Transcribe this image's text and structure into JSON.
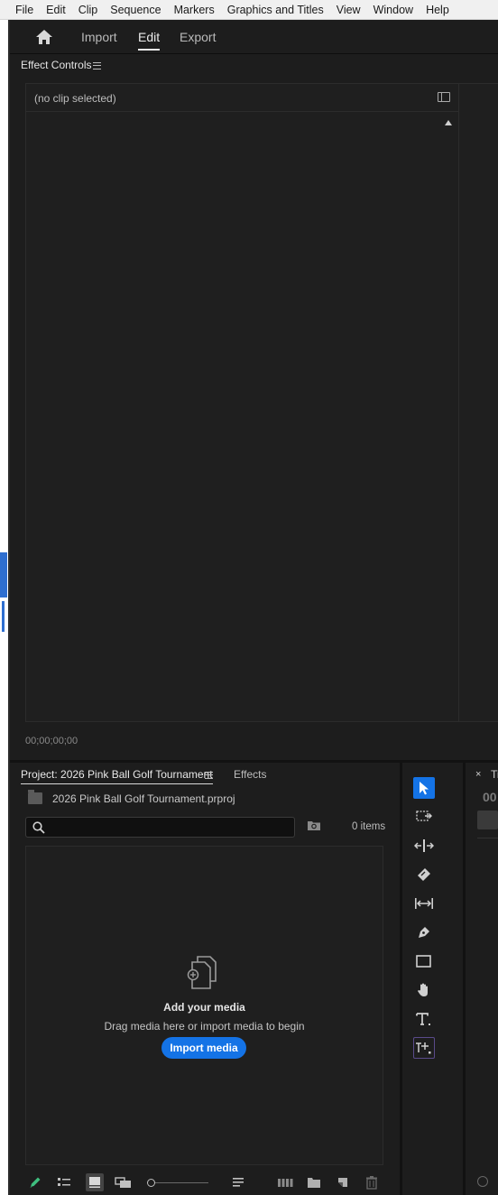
{
  "menu": [
    "File",
    "Edit",
    "Clip",
    "Sequence",
    "Markers",
    "Graphics and Titles",
    "View",
    "Window",
    "Help"
  ],
  "header": {
    "tabs": [
      {
        "label": "Import",
        "active": false
      },
      {
        "label": "Edit",
        "active": true
      },
      {
        "label": "Export",
        "active": false
      }
    ]
  },
  "effect_controls": {
    "title": "Effect Controls",
    "clip_status": "(no clip selected)",
    "timecode": "00;00;00;00"
  },
  "project": {
    "tab_label": "Project: 2026 Pink Ball Golf Tournament",
    "effects_tab": "Effects",
    "file_name": "2026 Pink Ball Golf Tournament.prproj",
    "search_value": "",
    "items_count": "0 items",
    "empty_title": "Add your media",
    "empty_subtitle": "Drag media here or import media to begin",
    "import_button": "Import media"
  },
  "timeline": {
    "close_glyph": "×",
    "tab_partial": "Ti",
    "timecode_partial": "00"
  },
  "colors": {
    "accent": "#1473e6",
    "panel_bg": "#1d1d1d",
    "app_bg": "#121212"
  }
}
